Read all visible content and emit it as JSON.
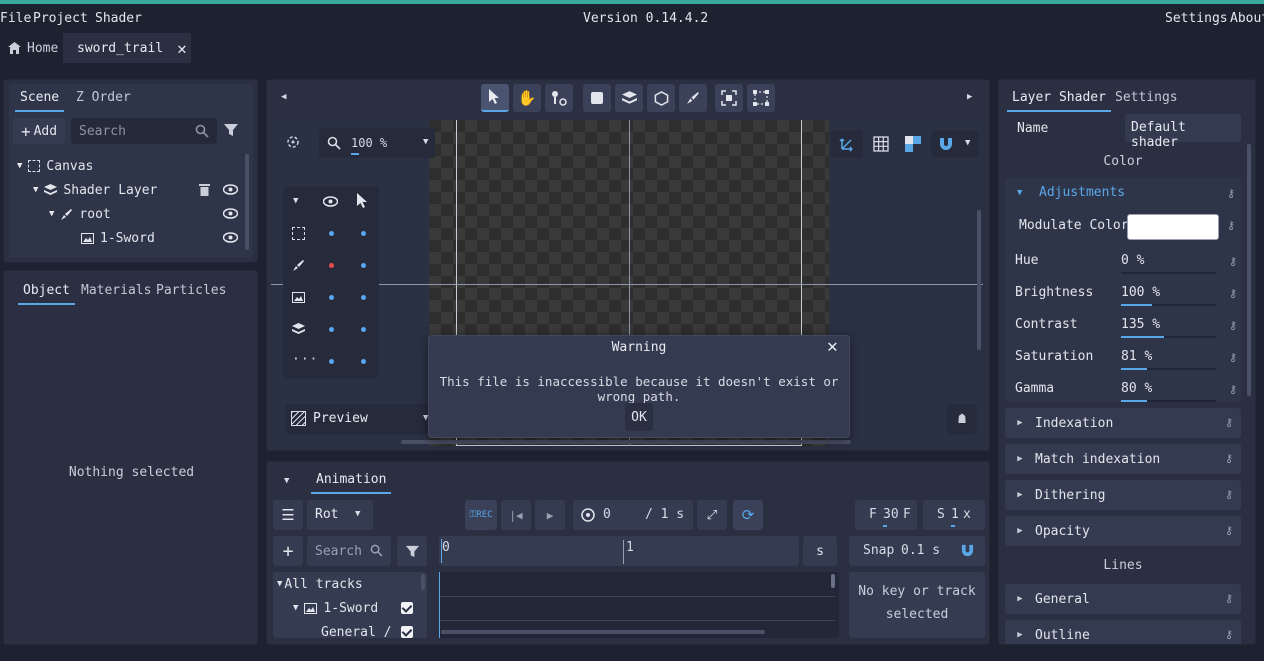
{
  "menu": {
    "file": "File",
    "project": "Project",
    "shader": "Shader",
    "version": "Version 0.14.4.2",
    "settings": "Settings",
    "about": "About"
  },
  "tabs": {
    "home": "Home",
    "active": "sword_trail"
  },
  "scene_panel": {
    "tab_scene": "Scene",
    "tab_zorder": "Z Order",
    "add_label": "Add",
    "search_placeholder": "Search",
    "tree": {
      "canvas": "Canvas",
      "shader_layer": "Shader Layer",
      "root": "root",
      "sword": "1-Sword"
    }
  },
  "object_panel": {
    "tab_object": "Object",
    "tab_materials": "Materials",
    "tab_particles": "Particles",
    "empty_message": "Nothing selected"
  },
  "viewport": {
    "zoom": "100 %",
    "preview_label": "Preview"
  },
  "dialog": {
    "title": "Warning",
    "message": "This file is inaccessible because it doesn't exist or wrong path.",
    "ok": "OK"
  },
  "animation": {
    "tab": "Animation",
    "animation_name": "Rot",
    "time_current": "0",
    "time_total": "/ 1 s",
    "fps_label": "F",
    "fps_value": "30",
    "fps_unit": "F",
    "speed_label": "S",
    "speed_value": "1",
    "speed_unit": "x",
    "search_placeholder": "Search",
    "ruler_start": "0",
    "ruler_mark": "1",
    "ruler_unit": "s",
    "snap_label": "Snap",
    "snap_value": "0.1 s",
    "no_key_line1": "No key or track",
    "no_key_line2": "selected",
    "tracks": {
      "all": "All tracks",
      "sword": "1-Sword",
      "general": "General /"
    }
  },
  "shader_panel": {
    "tab_layer_shader": "Layer Shader",
    "tab_settings": "Settings",
    "name_label": "Name",
    "name_value": "Default shader",
    "color_heading": "Color",
    "adjustments_label": "Adjustments",
    "modulate_label": "Modulate Color",
    "modulate_color": "#ffffff",
    "props": [
      {
        "label": "Hue",
        "value": "0 %",
        "fill": 0.0
      },
      {
        "label": "Brightness",
        "value": "100 %",
        "fill": 0.33
      },
      {
        "label": "Contrast",
        "value": "135 %",
        "fill": 0.45
      },
      {
        "label": "Saturation",
        "value": "81 %",
        "fill": 0.27
      },
      {
        "label": "Gamma",
        "value": "80 %",
        "fill": 0.27
      }
    ],
    "sections": {
      "indexation": "Indexation",
      "match_indexation": "Match indexation",
      "dithering": "Dithering",
      "opacity": "Opacity"
    },
    "lines_heading": "Lines",
    "sections2": {
      "general": "General",
      "outline": "Outline"
    }
  },
  "colors": {
    "accent": "#5aa7e8",
    "top_accent": "#3aa89b",
    "panel": "#2a3042",
    "background": "#1d2231"
  }
}
